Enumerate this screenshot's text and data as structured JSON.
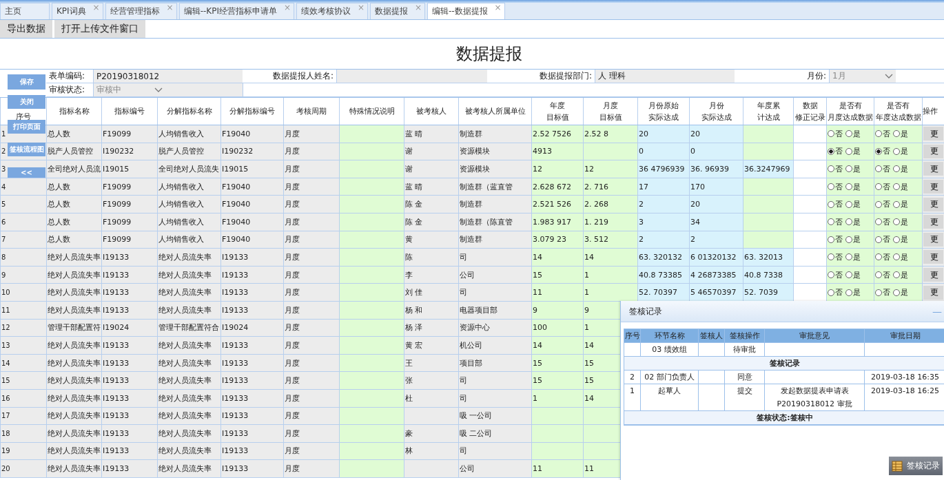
{
  "tabs": [
    {
      "label": "主页",
      "selected": false,
      "closable": false
    },
    {
      "label": "KPI词典",
      "selected": false,
      "closable": true
    },
    {
      "label": "经营管理指标",
      "selected": false,
      "closable": true
    },
    {
      "label": "编辑--KPI经营指标申请单",
      "selected": false,
      "closable": true
    },
    {
      "label": "绩效考核协议",
      "selected": false,
      "closable": true
    },
    {
      "label": "数据提报",
      "selected": false,
      "closable": true
    },
    {
      "label": "编辑--数据提报",
      "selected": true,
      "closable": true
    }
  ],
  "tab_close": "×",
  "toolbar": [
    "导出数据",
    "打开上传文件窗口"
  ],
  "title": "数据提报",
  "form": {
    "code_label": "表单编码:",
    "code": "P20190318012",
    "reporter_label": "数据提报人姓名:",
    "dept_label": "数据提报部门:",
    "dept": "人 理科",
    "month_label": "月份:",
    "month": "1月",
    "status_label": "审核状态:",
    "status": "审核中"
  },
  "side_buttons": [
    "保存",
    "关闭",
    "打印页面",
    "签核流程图",
    "<<"
  ],
  "columns": [
    {
      "lines": [
        "序号"
      ]
    },
    {
      "lines": [
        "指标名称"
      ]
    },
    {
      "lines": [
        "指标编号"
      ]
    },
    {
      "lines": [
        "分解指标名称"
      ]
    },
    {
      "lines": [
        "分解指标编号"
      ]
    },
    {
      "lines": [
        "考核周期"
      ]
    },
    {
      "lines": [
        "特殊情况说明"
      ]
    },
    {
      "lines": [
        "被考核人"
      ]
    },
    {
      "lines": [
        "被考核人所属单位"
      ]
    },
    {
      "lines": [
        "年度",
        "目标值"
      ]
    },
    {
      "lines": [
        "月度",
        "目标值"
      ]
    },
    {
      "lines": [
        "月份原始",
        "实际达成"
      ]
    },
    {
      "lines": [
        "月份",
        "实际达成"
      ]
    },
    {
      "lines": [
        "年度累",
        "计达成"
      ]
    },
    {
      "lines": [
        "数据",
        "修正记录"
      ]
    },
    {
      "lines": [
        "是否有",
        "月度达成数据"
      ]
    },
    {
      "lines": [
        "是否有",
        "年度达成数据"
      ]
    },
    {
      "lines": [
        "操作"
      ]
    }
  ],
  "rows": [
    {
      "seq": "1",
      "name": "总人数",
      "code": "F19099",
      "sub_name": "人均销售收入",
      "sub_code": "F19040",
      "period": "月度",
      "person": "蓝 晴",
      "unit": "制造群",
      "year_target": "2.52 7526",
      "month_target": "2.52 8",
      "month_raw": "20",
      "month_actual": "20",
      "monthly": [
        {
          "label": "否",
          "selected": false
        },
        {
          "label": "是",
          "selected": false
        }
      ],
      "yearly": [
        {
          "label": "否",
          "selected": false
        },
        {
          "label": "是",
          "selected": false
        }
      ],
      "action": "更"
    },
    {
      "seq": "2",
      "name": "脱产人员管控",
      "code": "I190232",
      "sub_name": "脱产人员管控",
      "sub_code": "I190232",
      "period": "月度",
      "person": "谢",
      "unit": "资源模块",
      "year_target": "4913",
      "month_raw": "0",
      "month_actual": "0",
      "monthly": [
        {
          "label": "否",
          "selected": true
        },
        {
          "label": "是",
          "selected": false
        }
      ],
      "yearly": [
        {
          "label": "否",
          "selected": true
        },
        {
          "label": "是",
          "selected": false
        }
      ],
      "action": "更"
    },
    {
      "seq": "3",
      "name": "全司绝对人员流",
      "code": "I19015",
      "sub_name": "全司绝对人员流失",
      "sub_code": "I19015",
      "period": "月度",
      "person": "谢",
      "unit": "资源模块",
      "year_target": "12",
      "month_target": "12",
      "month_raw": "36 4796939",
      "month_actual": "36. 96939",
      "year_cum": "36.3247969",
      "monthly": [
        {
          "label": "否",
          "selected": false
        },
        {
          "label": "是",
          "selected": false
        }
      ],
      "yearly": [
        {
          "label": "否",
          "selected": false
        },
        {
          "label": "是",
          "selected": false
        }
      ],
      "action": "更"
    },
    {
      "seq": "4",
      "name": "总人数",
      "code": "F19099",
      "sub_name": "人均销售收入",
      "sub_code": "F19040",
      "period": "月度",
      "person": "蓝 晴",
      "unit": "制造群（蓝直管",
      "year_target": "2.628 672",
      "month_target": "2. 716",
      "month_raw": "17",
      "month_actual": "170",
      "monthly": [
        {
          "label": "否",
          "selected": false
        },
        {
          "label": "是",
          "selected": false
        }
      ],
      "yearly": [
        {
          "label": "否",
          "selected": false
        },
        {
          "label": "是",
          "selected": false
        }
      ],
      "action": "更"
    },
    {
      "seq": "5",
      "name": "总人数",
      "code": "F19099",
      "sub_name": "人均销售收入",
      "sub_code": "F19040",
      "period": "月度",
      "person": "陈 金",
      "unit": "制造群",
      "year_target": "2.521 526",
      "month_target": "2. 268",
      "month_raw": "2",
      "month_actual": "20",
      "monthly": [
        {
          "label": "否",
          "selected": false
        },
        {
          "label": "是",
          "selected": false
        }
      ],
      "yearly": [
        {
          "label": "否",
          "selected": false
        },
        {
          "label": "是",
          "selected": false
        }
      ],
      "action": "更"
    },
    {
      "seq": "6",
      "name": "总人数",
      "code": "F19099",
      "sub_name": "人均销售收入",
      "sub_code": "F19040",
      "period": "月度",
      "person": "陈 金",
      "unit": "制造群（陈直管",
      "year_target": "1.983 917",
      "month_target": "1. 219",
      "month_raw": "3",
      "month_actual": "34",
      "monthly": [
        {
          "label": "否",
          "selected": false
        },
        {
          "label": "是",
          "selected": false
        }
      ],
      "yearly": [
        {
          "label": "否",
          "selected": false
        },
        {
          "label": "是",
          "selected": false
        }
      ],
      "action": "更"
    },
    {
      "seq": "7",
      "name": "总人数",
      "code": "F19099",
      "sub_name": "人均销售收入",
      "sub_code": "F19040",
      "period": "月度",
      "person": "黄",
      "unit": "制造群",
      "year_target": "3.079 23",
      "month_target": "3. 512",
      "month_raw": "2",
      "month_actual": "2",
      "monthly": [
        {
          "label": "否",
          "selected": false
        },
        {
          "label": "是",
          "selected": false
        }
      ],
      "yearly": [
        {
          "label": "否",
          "selected": false
        },
        {
          "label": "是",
          "selected": false
        }
      ],
      "action": "更"
    },
    {
      "seq": "8",
      "name": "绝对人员流失率",
      "code": "I19133",
      "sub_name": "绝对人员流失率",
      "sub_code": "I19133",
      "period": "月度",
      "person": "陈",
      "unit": "司",
      "year_target": "14",
      "month_target": "14",
      "month_raw": "63. 320132",
      "month_actual": "6 01320132",
      "year_cum": "63. 32013",
      "monthly": [
        {
          "label": "否",
          "selected": false
        },
        {
          "label": "是",
          "selected": false
        }
      ],
      "yearly": [
        {
          "label": "否",
          "selected": false
        },
        {
          "label": "是",
          "selected": false
        }
      ],
      "action": "更"
    },
    {
      "seq": "9",
      "name": "绝对人员流失率",
      "code": "I19133",
      "sub_name": "绝对人员流失率",
      "sub_code": "I19133",
      "period": "月度",
      "person": "李",
      "unit": "公司",
      "year_target": "15",
      "month_target": "1",
      "month_raw": "40.8 73385",
      "month_actual": "4 26873385",
      "year_cum": "40.8 7338",
      "monthly": [
        {
          "label": "否",
          "selected": false
        },
        {
          "label": "是",
          "selected": false
        }
      ],
      "yearly": [
        {
          "label": "否",
          "selected": false
        },
        {
          "label": "是",
          "selected": false
        }
      ],
      "action": "更"
    },
    {
      "seq": "10",
      "name": "绝对人员流失率",
      "code": "I19133",
      "sub_name": "绝对人员流失率",
      "sub_code": "I19133",
      "period": "月度",
      "person": "刘 佳",
      "unit": "司",
      "year_target": "11",
      "month_target": "1",
      "month_raw": "52. 70397",
      "month_actual": "5 46570397",
      "year_cum": "52. 7039",
      "monthly": [
        {
          "label": "否",
          "selected": false
        },
        {
          "label": "是",
          "selected": false
        }
      ],
      "yearly": [
        {
          "label": "否",
          "selected": false
        },
        {
          "label": "是",
          "selected": false
        }
      ],
      "action": "更"
    },
    {
      "seq": "11",
      "name": "绝对人员流失率",
      "code": "I19133",
      "sub_name": "绝对人员流失率",
      "sub_code": "I19133",
      "period": "月度",
      "person": "杨 和",
      "unit": "电器项目部",
      "year_target": "9",
      "month_target": "9"
    },
    {
      "seq": "12",
      "name": "管理干部配置符",
      "code": "I19024",
      "sub_name": "管理干部配置符合",
      "sub_code": "I19024",
      "period": "月度",
      "person": "杨 泽",
      "unit": "资源中心",
      "year_target": "100",
      "month_target": "1"
    },
    {
      "seq": "13",
      "name": "绝对人员流失率",
      "code": "I19133",
      "sub_name": "绝对人员流失率",
      "sub_code": "I19133",
      "period": "月度",
      "person": "黄 宏",
      "unit": "机公司",
      "year_target": "14",
      "month_target": "14"
    },
    {
      "seq": "14",
      "name": "绝对人员流失率",
      "code": "I19133",
      "sub_name": "绝对人员流失率",
      "sub_code": "I19133",
      "period": "月度",
      "person": "王",
      "unit": "项目部",
      "year_target": "15",
      "month_target": "15"
    },
    {
      "seq": "15",
      "name": "绝对人员流失率",
      "code": "I19133",
      "sub_name": "绝对人员流失率",
      "sub_code": "I19133",
      "period": "月度",
      "person": "张",
      "unit": "司",
      "year_target": "15",
      "month_target": "15"
    },
    {
      "seq": "16",
      "name": "绝对人员流失率",
      "code": "I19133",
      "sub_name": "绝对人员流失率",
      "sub_code": "I19133",
      "period": "月度",
      "person": "杜",
      "unit": "司",
      "year_target": "1",
      "month_target": "14"
    },
    {
      "seq": "17",
      "name": "绝对人员流失率",
      "code": "I19133",
      "sub_name": "绝对人员流失率",
      "sub_code": "I19133",
      "period": "月度",
      "unit": "吸 一公司"
    },
    {
      "seq": "18",
      "name": "绝对人员流失率",
      "code": "I19133",
      "sub_name": "绝对人员流失率",
      "sub_code": "I19133",
      "period": "月度",
      "person": "豪",
      "unit": "吸 二公司"
    },
    {
      "seq": "19",
      "name": "绝对人员流失率",
      "code": "I19133",
      "sub_name": "绝对人员流失率",
      "sub_code": "I19133",
      "period": "月度",
      "person": "林",
      "unit": "司"
    },
    {
      "seq": "20",
      "name": "绝对人员流失率",
      "code": "I19133",
      "sub_name": "绝对人员流失率",
      "sub_code": "I19133",
      "period": "月度",
      "unit": "公司",
      "year_target": "11",
      "month_target": "11"
    }
  ],
  "dialog": {
    "title": "签核记录",
    "minimize": "—",
    "columns": [
      "序号",
      "环节名称",
      "签核人",
      "签核操作",
      "审批意见",
      "审批日期"
    ],
    "rows": [
      {
        "kind": "record",
        "step": "03 绩效组",
        "action": "待审批"
      },
      {
        "kind": "section",
        "text": "签核记录"
      },
      {
        "kind": "record",
        "seq": "2",
        "step": "02 部门负责人",
        "action": "同意",
        "date": "2019-03-18 16:35"
      },
      {
        "kind": "record",
        "seq": "1",
        "step": "起草人",
        "action": "提交",
        "opinion": "发起数据提表申请表 P20190318012 审批",
        "date": "2019-03-18 16:25"
      },
      {
        "kind": "section",
        "text": "签核状态:签核中"
      }
    ]
  },
  "records_button": "签核记录"
}
